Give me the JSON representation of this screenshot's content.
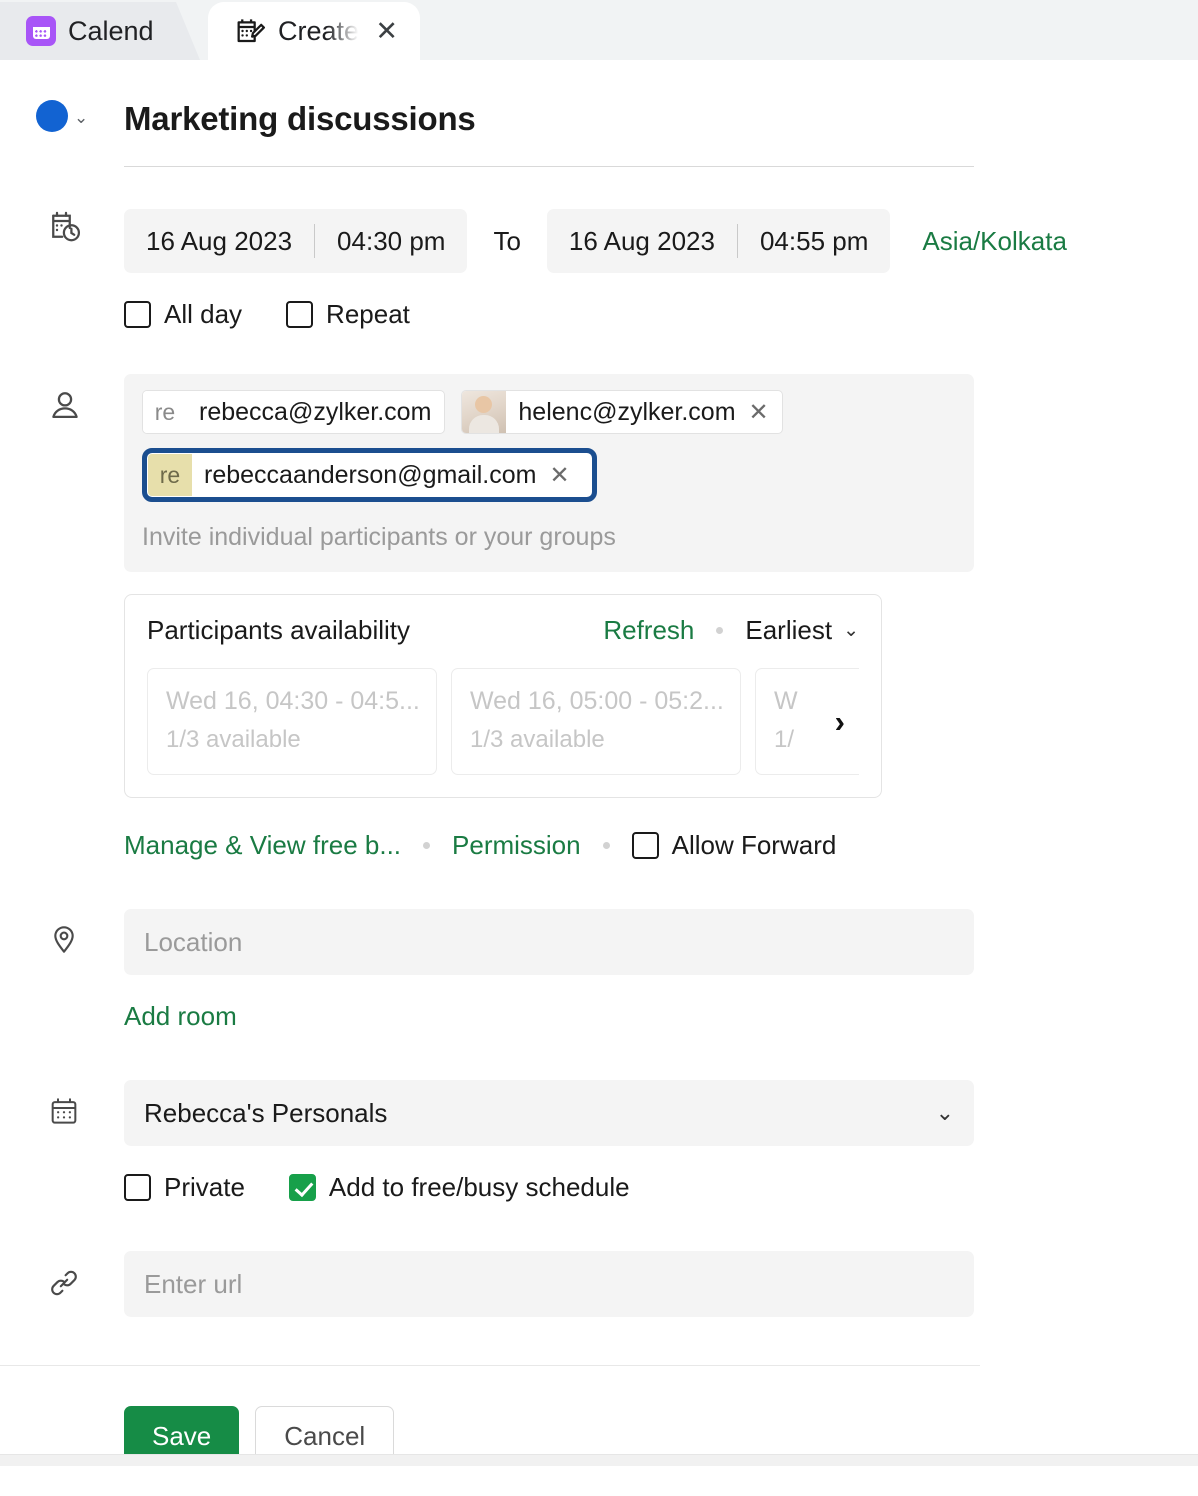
{
  "browser": {
    "tabs": [
      {
        "label": "Calend",
        "icon": "calendar-app-icon",
        "active": false
      },
      {
        "label": "Create E",
        "icon": "create-event-icon",
        "active": true,
        "close": "✕"
      }
    ]
  },
  "event": {
    "title": "Marketing discussions",
    "color_hex": "#1263d2",
    "color_dropdown_chevron": "⌄",
    "schedule": {
      "icon": "calendar-clock-icon",
      "start_date": "16 Aug 2023",
      "start_time": "04:30 pm",
      "to_label": "To",
      "end_date": "16 Aug 2023",
      "end_time": "04:55 pm",
      "timezone": "Asia/Kolkata"
    },
    "options": [
      {
        "label": "All day",
        "checked": false
      },
      {
        "label": "Repeat",
        "checked": false
      }
    ],
    "participants": {
      "icon": "person-icon",
      "chips": [
        {
          "avatar_text": "re",
          "avatar_style": "initials",
          "email": "rebecca@zylker.com",
          "removable": false,
          "selected": false
        },
        {
          "avatar_text": "",
          "avatar_style": "photo",
          "email": "helenc@zylker.com",
          "remove": "✕",
          "removable": true,
          "selected": false
        },
        {
          "avatar_text": "re",
          "avatar_style": "initials-tan",
          "email": "rebeccaanderson@gmail.com",
          "remove": "✕",
          "removable": true,
          "selected": true
        }
      ],
      "placeholder": "Invite individual participants or your groups"
    },
    "availability": {
      "heading": "Participants availability",
      "refresh_label": "Refresh",
      "sort_label": "Earliest",
      "sort_chevron": "⌄",
      "next_arrow": "›",
      "slots": [
        {
          "range": "Wed 16, 04:30 - 04:5...",
          "available": "1/3 available"
        },
        {
          "range": "Wed 16, 05:00 - 05:2...",
          "available": "1/3 available"
        },
        {
          "range": "W",
          "available": "1/"
        }
      ]
    },
    "meta_links": {
      "manage_view": "Manage & View free b...",
      "permission": "Permission",
      "allow_forward": {
        "label": "Allow Forward",
        "checked": false
      }
    },
    "location": {
      "icon": "location-pin-icon",
      "placeholder": "Location",
      "value": "",
      "add_room": "Add room"
    },
    "calendar": {
      "icon": "calendar-icon",
      "selected": "Rebecca's Personals",
      "chevron": "⌄",
      "checkboxes": [
        {
          "label": "Private",
          "checked": false
        },
        {
          "label": "Add to free/busy schedule",
          "checked": true
        }
      ]
    },
    "url": {
      "icon": "link-icon",
      "placeholder": "Enter url",
      "value": ""
    }
  },
  "footer": {
    "save_label": "Save",
    "cancel_label": "Cancel"
  },
  "colors": {
    "accent_green": "#1a7b43",
    "save_green": "#168c46",
    "event_blue": "#1263d2",
    "selection_blue": "#1b4e8f",
    "checkbox_green": "#17a04a"
  }
}
